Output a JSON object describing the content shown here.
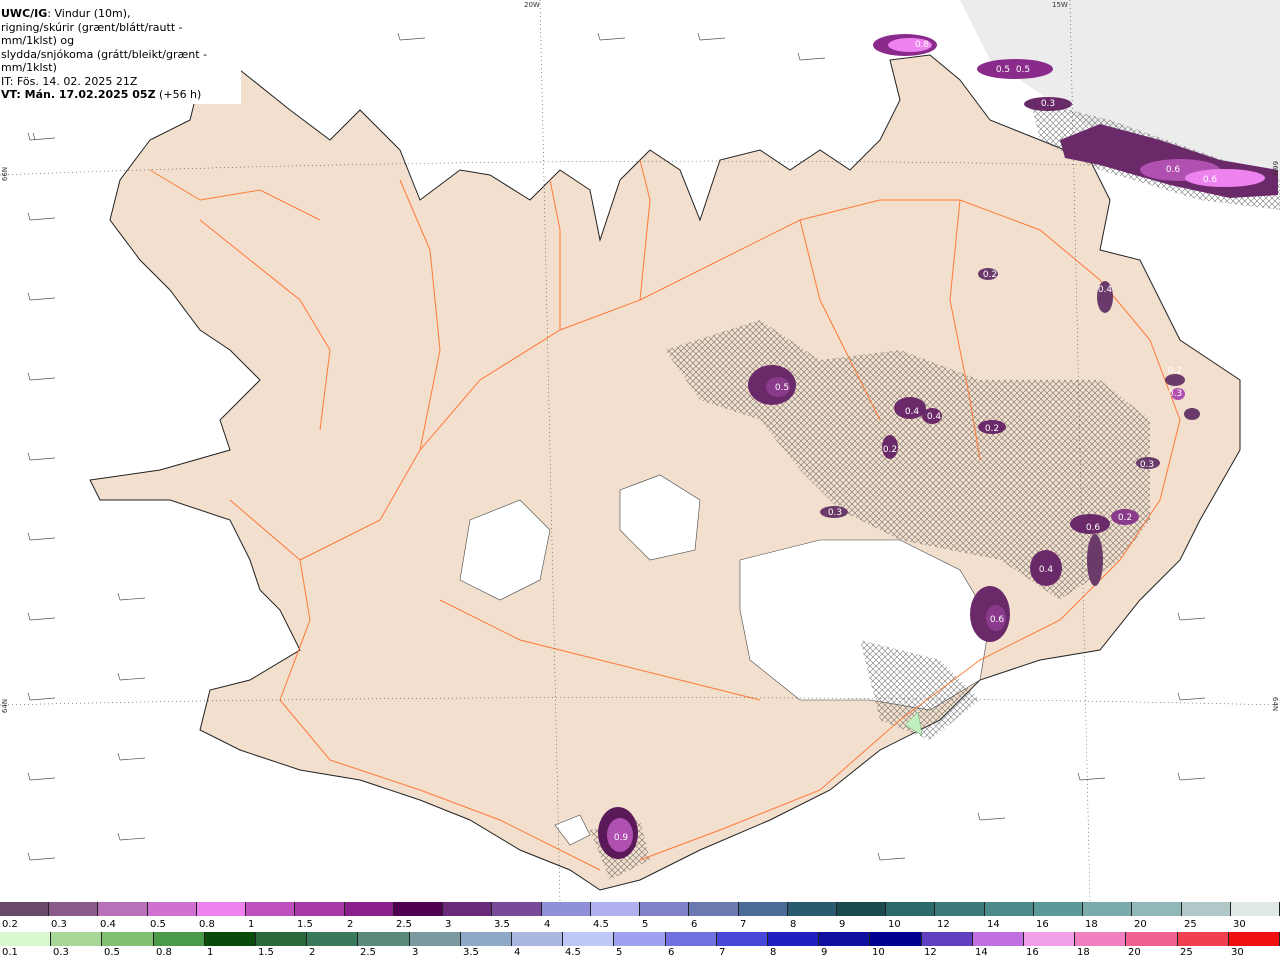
{
  "title": {
    "model": "UWC/IG",
    "line1_rest": ": Vindur (10m),",
    "line2": "rigning/skúrir (grænt/blátt/rautt - mm/1klst) og",
    "line3": "slydda/snjókoma (grátt/bleikt/grænt - mm/1klst)",
    "line4": "IT: Fös. 14. 02. 2025 21Z",
    "line5_bold": "VT: Mán. 17.02.2025 05Z",
    "line5_rest": " (+56 h)"
  },
  "coords": {
    "lon_top_left": "20W",
    "lon_top_right": "15W",
    "lat_left_upper": "66N",
    "lat_left_lower": "64N",
    "lat_right_upper": "66N",
    "lat_right_lower": "64N"
  },
  "precip_labels": [
    "0.8",
    "0.5",
    "0.5",
    "0.3",
    "0.6",
    "0.6",
    "0.2",
    "0.5",
    "0.4",
    "0.4",
    "0.2",
    "0.2",
    "0.4",
    "0.3",
    "0.6",
    "0.2",
    "0.3",
    "0.4",
    "0.6",
    "0.9",
    "0.2",
    "0.3"
  ],
  "legend_snow": {
    "labels": [
      "0.2",
      "0.3",
      "0.4",
      "0.5",
      "0.8",
      "1",
      "1.5",
      "2",
      "2.5",
      "3",
      "3.5",
      "4",
      "4.5",
      "5",
      "6",
      "7",
      "8",
      "9",
      "10",
      "12",
      "14",
      "16",
      "18",
      "20",
      "25",
      "30"
    ],
    "colors": [
      "#6a4a6a",
      "#8a5a8a",
      "#b870b8",
      "#d070d0",
      "#ee82ee",
      "#c050c0",
      "#a838a8",
      "#8a208a",
      "#500050",
      "#6a2a7a",
      "#7a4a9a",
      "#9090d8",
      "#b0b0f0",
      "#8080c8",
      "#6a7ab0",
      "#4a6a98",
      "#2a5a70",
      "#1a4a50",
      "#2a6a6a",
      "#3a7a7a",
      "#4a8a8a",
      "#5a9a9a",
      "#7aaaaa",
      "#90b8b8",
      "#b0c8c8",
      "#e0e8e8"
    ]
  },
  "legend_rain": {
    "labels": [
      "0.1",
      "0.3",
      "0.5",
      "0.8",
      "1",
      "1.5",
      "2",
      "2.5",
      "3",
      "3.5",
      "4",
      "4.5",
      "5",
      "6",
      "7",
      "8",
      "9",
      "10",
      "12",
      "14",
      "16",
      "18",
      "20",
      "25",
      "30"
    ],
    "colors": [
      "#d8f8d0",
      "#a8d898",
      "#80c070",
      "#4a9a4a",
      "#0a4a0a",
      "#2a6a3a",
      "#3a7a5a",
      "#5a8a7a",
      "#7a9aa0",
      "#90a8c8",
      "#a8b8e0",
      "#c0c8f8",
      "#a0a0f0",
      "#7070e0",
      "#4848d8",
      "#2020c0",
      "#1010a0",
      "#000090",
      "#6040c0",
      "#c070e0",
      "#f0a0e8",
      "#f080c0",
      "#f06090",
      "#f04050",
      "#f01010"
    ]
  }
}
